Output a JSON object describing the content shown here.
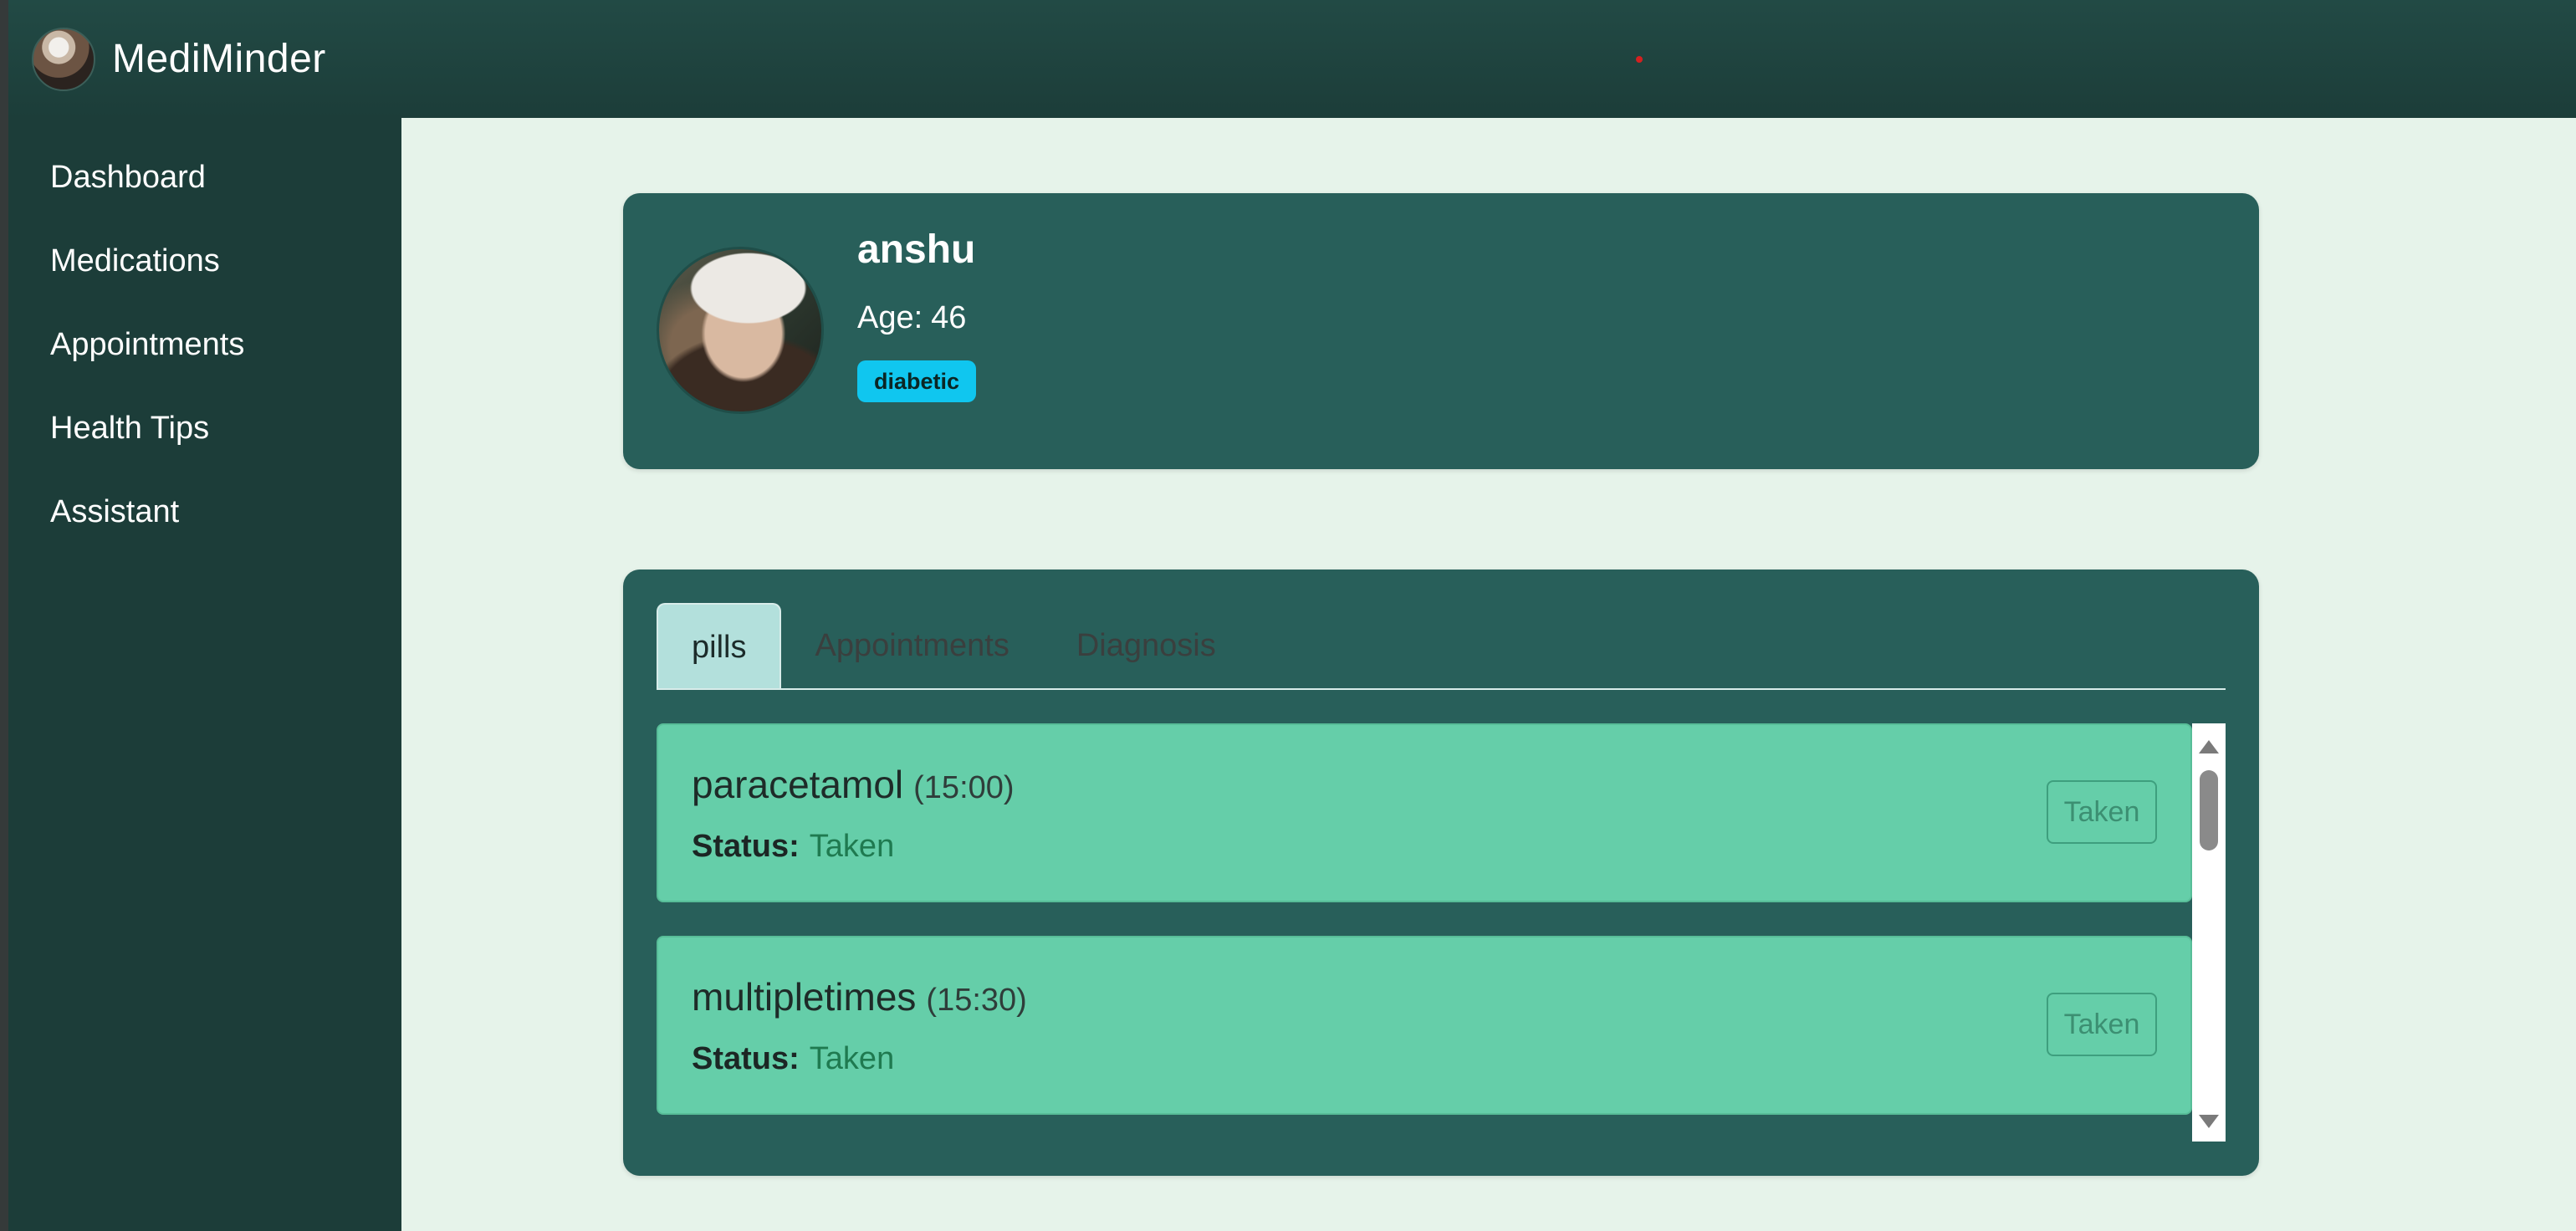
{
  "app": {
    "name": "MediMinder"
  },
  "sidebar": {
    "items": [
      {
        "label": "Dashboard"
      },
      {
        "label": "Medications"
      },
      {
        "label": "Appointments"
      },
      {
        "label": "Health Tips"
      },
      {
        "label": "Assistant"
      }
    ]
  },
  "profile": {
    "name": "anshu",
    "age_label": "Age:",
    "age_value": "46",
    "condition_badge": "diabetic"
  },
  "tabs": [
    {
      "label": "pills",
      "active": true
    },
    {
      "label": "Appointments",
      "active": false
    },
    {
      "label": "Diagnosis",
      "active": false
    }
  ],
  "pills": [
    {
      "name": "paracetamol",
      "time": "(15:00)",
      "status_label": "Status:",
      "status_value": "Taken",
      "action_label": "Taken"
    },
    {
      "name": "multipletimes",
      "time": "(15:30)",
      "status_label": "Status:",
      "status_value": "Taken",
      "action_label": "Taken"
    }
  ],
  "colors": {
    "topbar": "#1c3d39",
    "sidebar": "#1c3d39",
    "card": "#285f5a",
    "pill_card": "#65cea9",
    "badge": "#10c6ef",
    "active_tab": "#b3e0dc",
    "background": "#e6f3ea"
  },
  "icons": {
    "brand_avatar": "user-avatar-icon",
    "scroll_up": "scroll-up-arrow-icon",
    "scroll_down": "scroll-down-arrow-icon"
  }
}
